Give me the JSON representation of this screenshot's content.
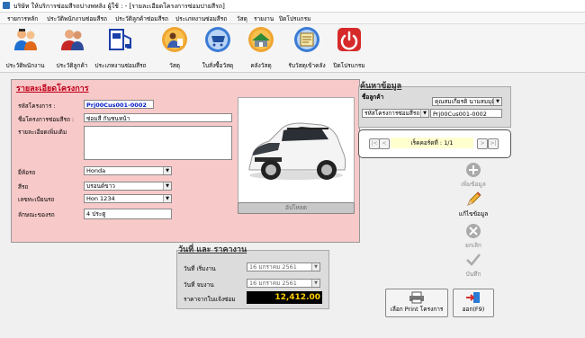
{
  "window": {
    "title": "บริษัท ให้บริการซ่อมสีรถบ่างพหลิง  ผู้ใช้ :   - [รายละเอียดโครงการซ่อมปายสีรถ]"
  },
  "menu": [
    "รายการหลัก",
    "ประวัติพนักงานซ่อมสีรถ",
    "ประวัติลูกค้าซ่อมสีรถ",
    "ประเภทงานซ่อมสีรถ",
    "วัสดุ",
    "รายงาน",
    "ปิดโปรแกรม"
  ],
  "toolbar": [
    {
      "label": "ประวัติพนักงาน",
      "icon": "employees-icon"
    },
    {
      "label": "ประวัติลูกค้า",
      "icon": "customers-icon"
    },
    {
      "label": "ประเภทงานซ่อมสีรถ",
      "icon": "paint-job-icon"
    },
    {
      "label": "วัสดุ",
      "icon": "materials-icon"
    },
    {
      "label": "ใบสั่งซื้อวัสดุ",
      "icon": "purchase-order-icon"
    },
    {
      "label": "คลังวัสดุ",
      "icon": "warehouse-icon"
    },
    {
      "label": "รับวัสดุเข้าคลัง",
      "icon": "receive-stock-icon"
    },
    {
      "label": "ปิดโปรแกรม",
      "icon": "power-icon"
    }
  ],
  "project": {
    "title": "รายละเอียดโครงการ",
    "code_label": "รหัสโครงการ :",
    "code_value": "Prj00Cus001-0002",
    "name_label": "ชื่อโครงการซ่อมสีรถ :",
    "name_value": "ซ่อมสี กันชนหน้า",
    "detail_label": "รายละเอียดเพิ่มเติม",
    "brand_label": "ยี่ห้อรถ",
    "brand_value": "Honda",
    "color_label": "สีรถ",
    "color_value": "บรอนด์ขาว",
    "plate_label": "เลขทะเบียนรถ",
    "plate_value": "Hon 1234",
    "trait_label": "ลักษณะของรถ",
    "trait_value": "4 ประตู",
    "upload_label": "อัปโหลด"
  },
  "search": {
    "title": "ค้นหาข้อมูล",
    "customer_label": "ชื่อลูกค้า",
    "customer_value": "คุณสมเกียรติ นามสมมุติ",
    "field_select": "รหัสโครงการซ่อมสีรถ",
    "field_value": "Prj00Cus001-0002"
  },
  "nav": {
    "record_text": "เร็คคอร์ดที่ : 1/1",
    "first": "|<",
    "prev": "<",
    "next": ">",
    "last": ">|"
  },
  "dates": {
    "title": "วันที่ และ ราคางาน",
    "start_label": "วันที่ เริ่มงาน",
    "start_value": "16  มกราคม  2561",
    "end_label": "วันที่ จบงาน",
    "end_value": "16  มกราคม  2561",
    "price_label": "ราคาจากใบแจ้งซ่อม",
    "price_value": "12,412.00"
  },
  "actions": {
    "add": "เพิ่มข้อมูล",
    "edit": "แก้ไขข้อมูล",
    "cancel": "ยกเลิก",
    "save": "บันทึก",
    "print": "เลือก Print โครงการ",
    "exit": "ออก(F9)"
  }
}
